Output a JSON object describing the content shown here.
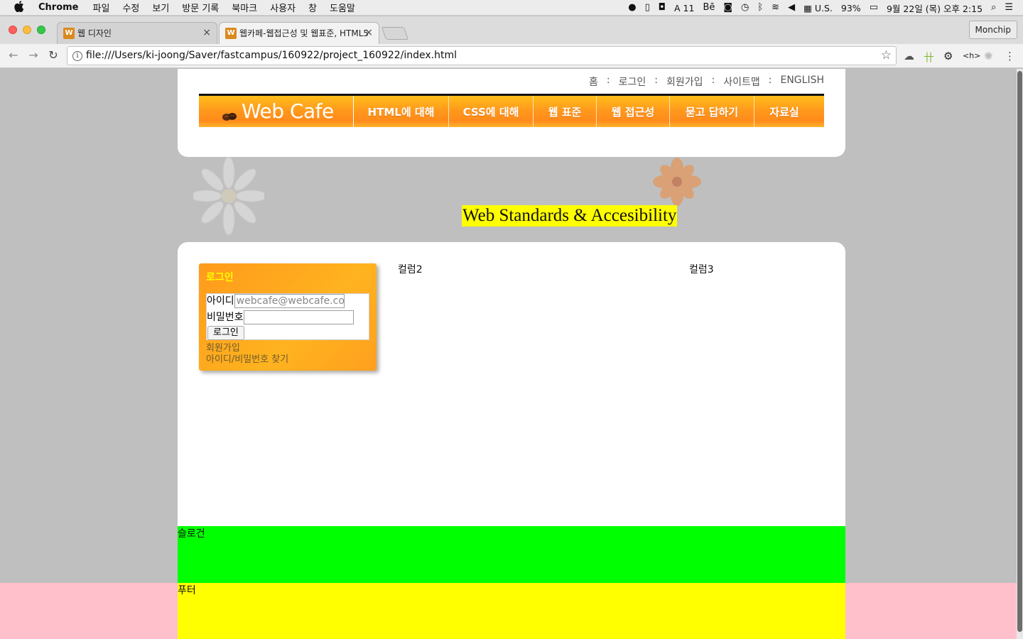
{
  "menubar": {
    "app": "Chrome",
    "items": [
      "파일",
      "수정",
      "보기",
      "방문 기록",
      "북마크",
      "사용자",
      "창",
      "도움말"
    ],
    "battery": "93%",
    "input_source": "U.S.",
    "datetime": "9월 22일 (목) 오후 2:15",
    "adobe_count": "11"
  },
  "tabs": [
    {
      "title": "웹 디자인",
      "active": false
    },
    {
      "title": "웹카페-웹접근성 및 웹표준, HTML5",
      "active": true
    }
  ],
  "profile": "Monchip",
  "address": "file:///Users/ki-joong/Saver/fastcampus/160922/project_160922/index.html",
  "util_nav": [
    "홈",
    "로그인",
    "회원가입",
    "사이트맵",
    "ENGLISH"
  ],
  "util_sep": ":",
  "logo": "Web Cafe",
  "gnb": [
    "HTML에 대해",
    "CSS에 대해",
    "웹 표준",
    "웹 접근성",
    "묻고 답하기",
    "자료실"
  ],
  "visual_title": "Web Standards & Accesibility",
  "login": {
    "title": "로그인",
    "id_label": "아이디",
    "id_value": "webcafe@webcafe.com",
    "pw_label": "비밀번호",
    "pw_value": "",
    "submit": "로그인",
    "join": "회원가입",
    "find": "아이디/비밀번호 찾기"
  },
  "columns": [
    "컬럼2",
    "컬럼3"
  ],
  "slogan": "슬로건",
  "footer": "푸터",
  "colors": {
    "slogan_bg": "#00ff00",
    "footer_bg": "#ffff00",
    "footer_outer": "#ffc0cb",
    "page_bg": "#bfbfbf",
    "accent": "#ff9a1c"
  }
}
